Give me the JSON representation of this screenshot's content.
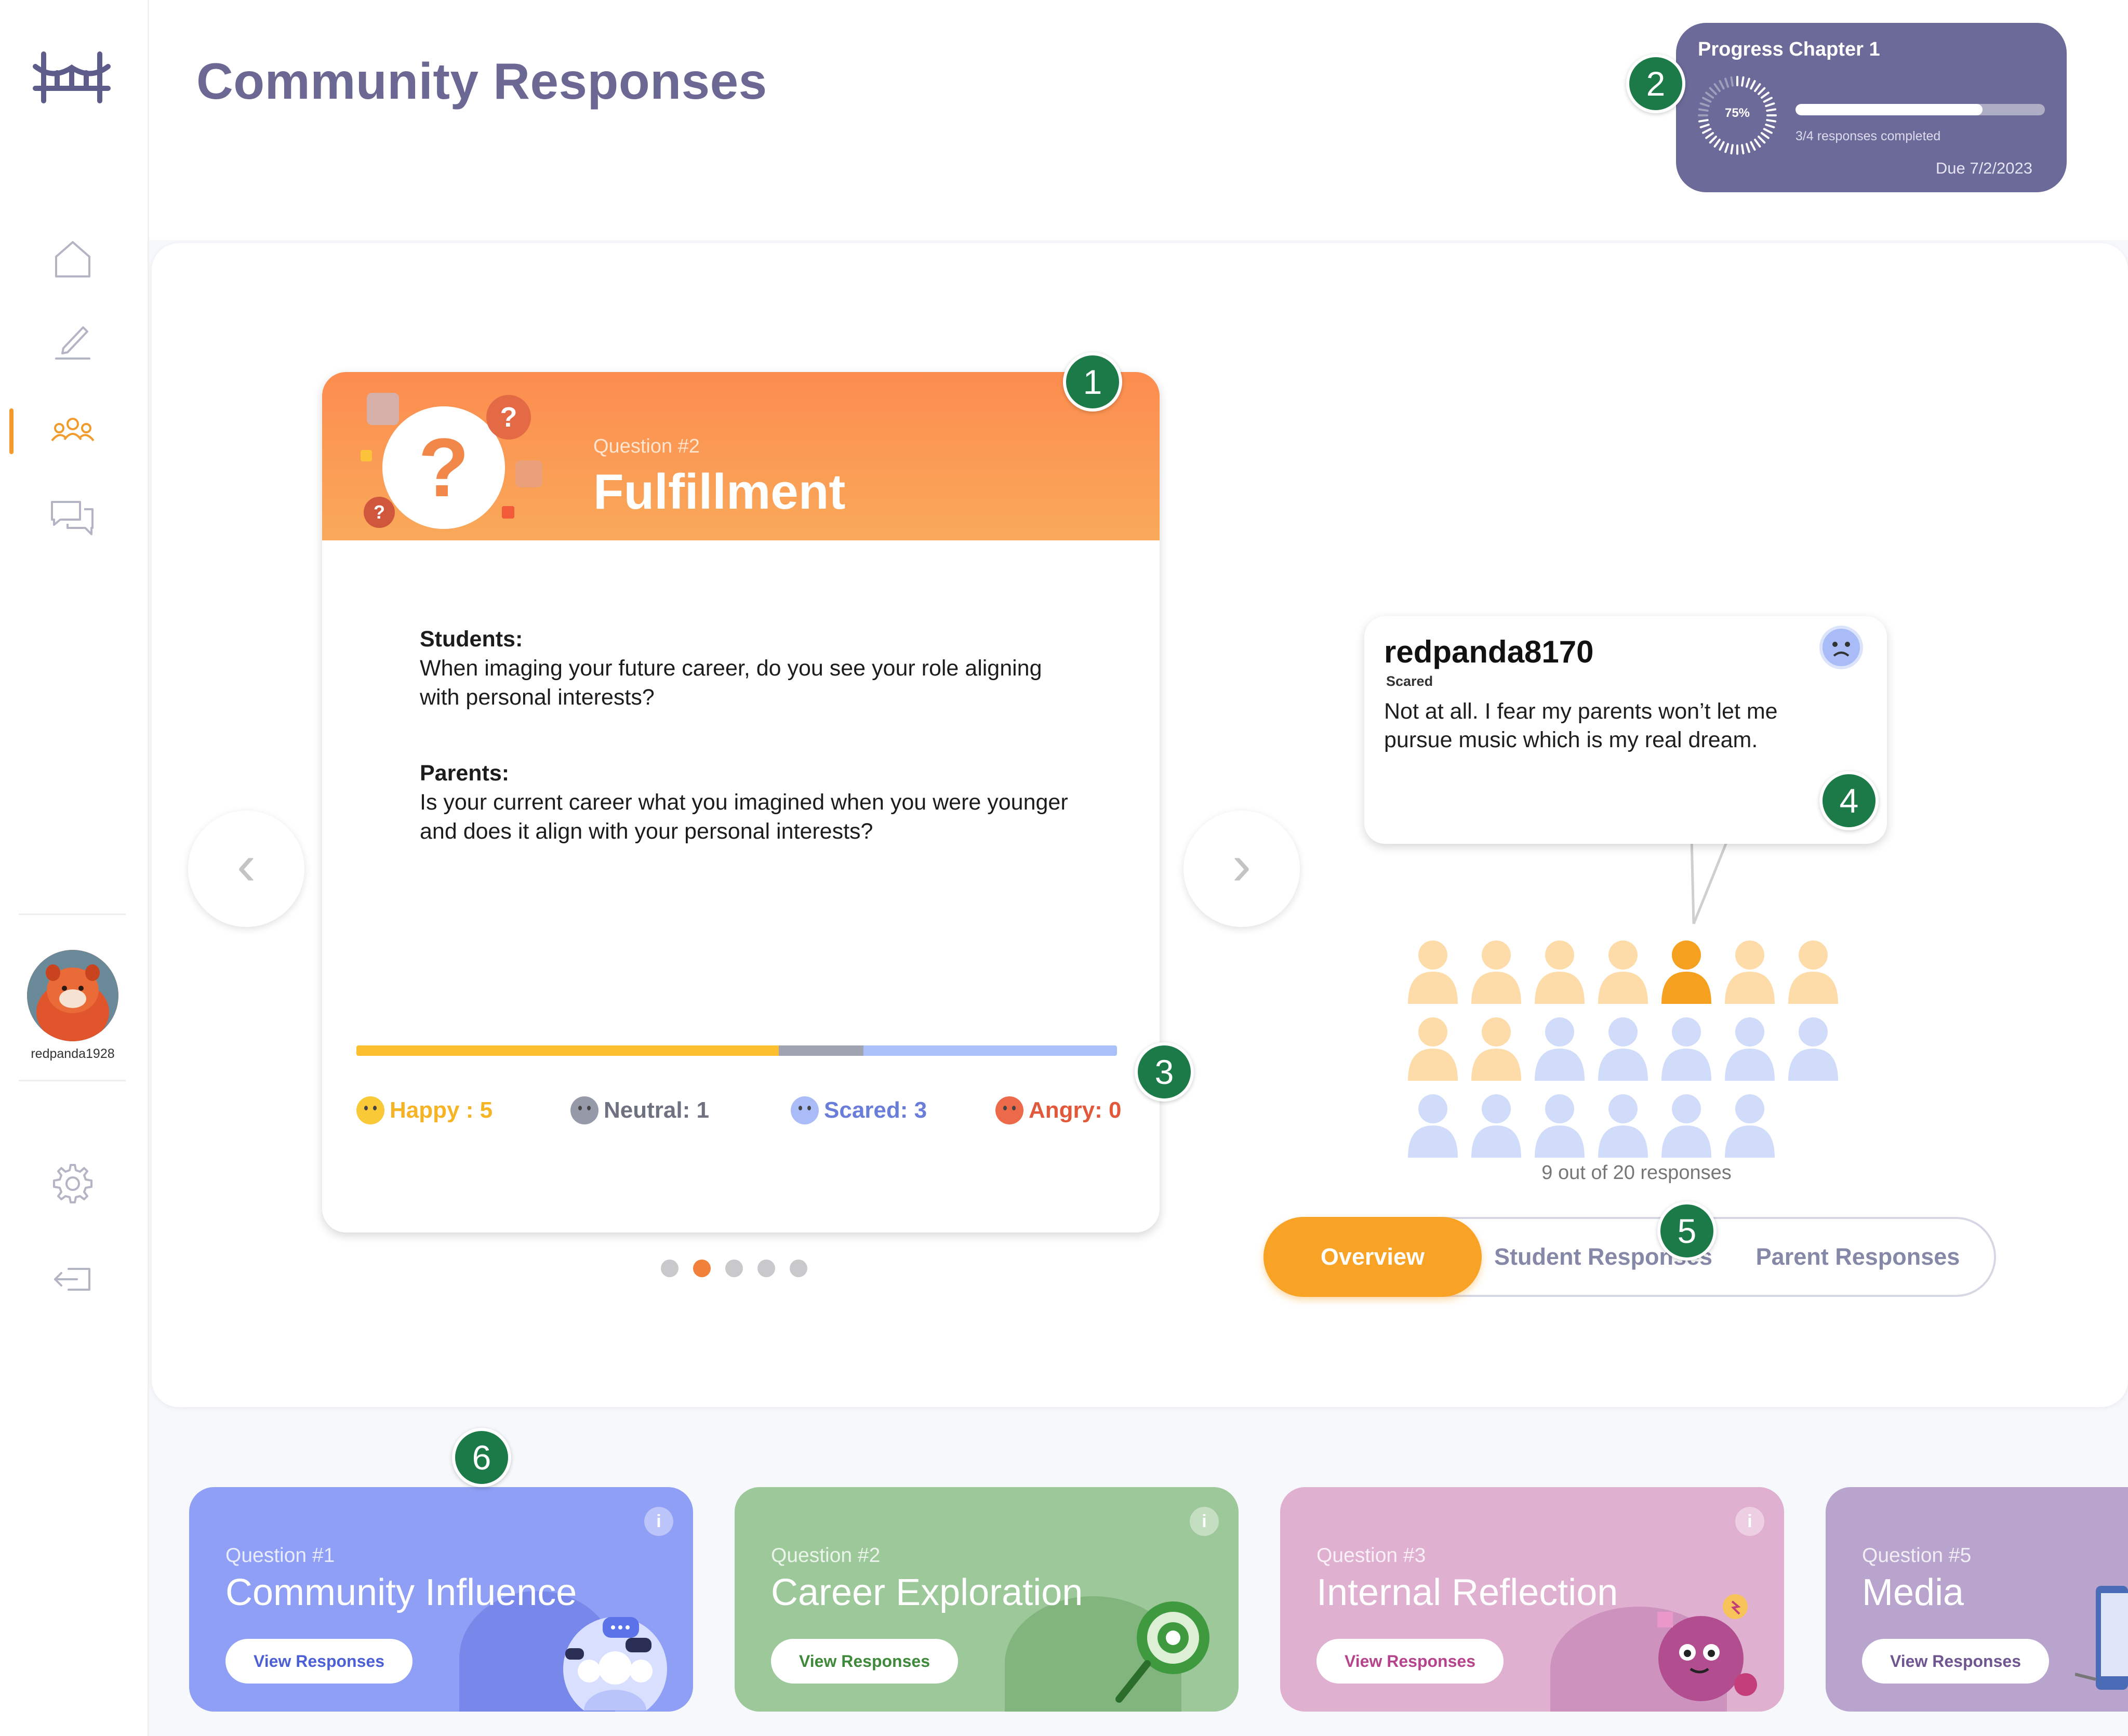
{
  "page": {
    "title": "Community Responses"
  },
  "sidebar": {
    "items": [
      {
        "name": "home",
        "icon": "home-icon"
      },
      {
        "name": "edit",
        "icon": "pencil-icon"
      },
      {
        "name": "community",
        "icon": "people-icon",
        "active": true
      },
      {
        "name": "messages",
        "icon": "chat-icon"
      }
    ],
    "user": {
      "username": "redpanda1928"
    },
    "bottom_items": [
      {
        "name": "settings",
        "icon": "gear-icon"
      },
      {
        "name": "logout",
        "icon": "logout-icon"
      }
    ],
    "accent": "#f39a2c"
  },
  "progress": {
    "title": "Progress Chapter 1",
    "percent_label": "75%",
    "fraction": 0.75,
    "subtitle": "3/4 responses completed",
    "due": "Due 7/2/2023"
  },
  "question_card": {
    "number": "Question #2",
    "title": "Fulfillment",
    "students_label": "Students:",
    "students_text": "When imaging your future career, do you see your role aligning with personal interests?",
    "parents_label": "Parents:",
    "parents_text": "Is your current career what you imagined when you were younger and does it align with your personal interests?",
    "moods": [
      {
        "label": "Happy",
        "sep": " : ",
        "count": "5",
        "color": "#f6b324",
        "face": "#f9c938"
      },
      {
        "label": "Neutral",
        "sep": ": ",
        "count": "1",
        "color": "#6e7180",
        "face": "#9699a8"
      },
      {
        "label": "Scared",
        "sep": ": ",
        "count": "3",
        "color": "#6a7ed9",
        "face": "#a9bcf7"
      },
      {
        "label": "Angry",
        "sep": ": ",
        "count": "0",
        "color": "#e2583a",
        "face": "#ec6a4a"
      }
    ],
    "mood_bar": [
      {
        "value": 5,
        "color": "#fbbf2e"
      },
      {
        "value": 1,
        "color": "#a0a3b2"
      },
      {
        "value": 3,
        "color": "#a9c1f8"
      }
    ],
    "carousel": {
      "count": 5,
      "active": 1
    }
  },
  "response": {
    "username": "redpanda8170",
    "mood": "Scared",
    "text": "Not at all. I fear my parents won’t let me pursue music which is my real dream.",
    "count_text": "9 out of 20 responses",
    "people": {
      "total": 20,
      "responded": 9,
      "highlighted": 4,
      "colors": {
        "responded": "#fddcaa",
        "highlighted": "#f5a11f",
        "pending": "#d0dcfa"
      }
    }
  },
  "tabs": [
    {
      "label": "Overview",
      "active": true
    },
    {
      "label": "Student Responses",
      "active": false
    },
    {
      "label": "Parent Responses",
      "active": false
    }
  ],
  "markers": [
    "1",
    "2",
    "3",
    "4",
    "5",
    "6"
  ],
  "bottom_cards": [
    {
      "number": "Question #1",
      "title": "Community Influence",
      "button": "View Responses",
      "bg": "#8e9ff5",
      "btn_color": "#4c5fd5",
      "info": "i"
    },
    {
      "number": "Question #2",
      "title": "Career Exploration",
      "button": "View Responses",
      "bg": "#9dc89a",
      "btn_color": "#3e8a3a",
      "info": "i"
    },
    {
      "number": "Question #3",
      "title": "Internal Reflection",
      "button": "View Responses",
      "bg": "#dfb0cf",
      "btn_color": "#b5448c",
      "info": "i"
    },
    {
      "number": "Question #5",
      "title": "Media",
      "button": "View Responses",
      "bg": "#b8a4cd",
      "btn_color": "#6f5690",
      "info": "i"
    }
  ]
}
